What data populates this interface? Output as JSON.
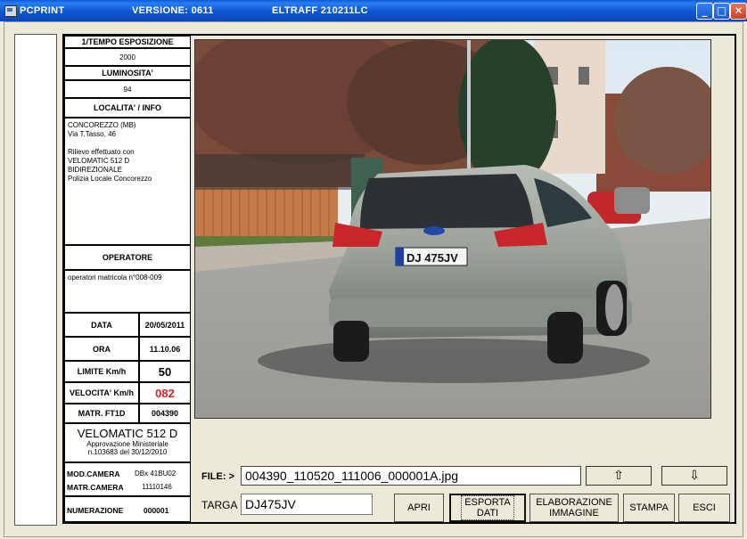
{
  "window": {
    "title": "PCPRINT",
    "version": "VERSIONE:  0611",
    "eltraff": "ELTRAFF   210211LC",
    "minimize": "_",
    "maximize": "□",
    "close": "✕"
  },
  "info": {
    "tempo_label": "1/TEMPO ESPOSIZIONE",
    "tempo_value": "2000",
    "lum_label": "LUMINOSITA'",
    "lum_value": "94",
    "loc_label": "LOCALITA' / INFO",
    "loc_value": "CONCOREZZO (MB)\nVia T.Tasso, 46\n\nRilievo effettuato con\nVELOMATIC 512 D\nBIDIREZIONALE\nPolizia Locale Concorezzo",
    "op_label": "OPERATORE",
    "op_value": "operatori matricola n°008-009",
    "data_label": "DATA",
    "data_value": "20/05/2011",
    "ora_label": "ORA",
    "ora_value": "11.10.06",
    "limite_label": "LIMITE Km/h",
    "limite_value": "50",
    "velocita_label": "VELOCITA' Km/h",
    "velocita_value": "082",
    "matr_label": "MATR. FT1D",
    "matr_value": "004390",
    "device_name": "VELOMATIC 512 D",
    "device_approval": "Approvazione Ministeriale\nn.103683 del 30/12/2010",
    "mod_camera_label": "MOD.CAMERA",
    "mod_camera_value": "DBx 41BU02",
    "matr_camera_label": "MATR.CAMERA",
    "matr_camera_value": "11110146",
    "numerazione_label": "NUMERAZIONE",
    "numerazione_value": "000001"
  },
  "photo": {
    "plate_text": "DJ 475JV"
  },
  "file": {
    "label": "FILE: >",
    "value": "004390_110520_111006_000001A.jpg",
    "up": "⇧",
    "down": "⇩"
  },
  "targa": {
    "label": "TARGA",
    "value": "DJ475JV"
  },
  "buttons": {
    "apri": "APRI",
    "esporta": "ESPORTA\nDATI",
    "elaborazione": "ELABORAZIONE\nIMMAGINE",
    "stampa": "STAMPA",
    "esci": "ESCI"
  }
}
